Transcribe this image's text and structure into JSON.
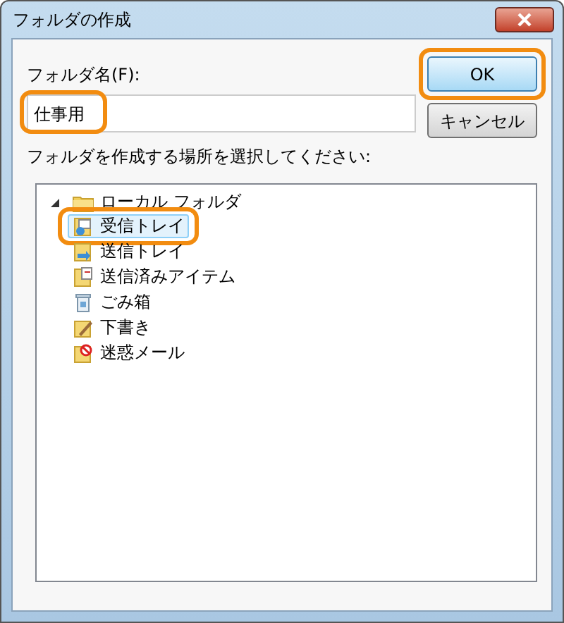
{
  "window": {
    "title": "フォルダの作成"
  },
  "name_field": {
    "label": "フォルダ名(F):",
    "value": "仕事用",
    "highlighted": true
  },
  "buttons": [
    {
      "label": "OK",
      "default": true,
      "highlighted": true
    },
    {
      "label": "キャンセル",
      "default": false,
      "highlighted": false
    }
  ],
  "location_label": "フォルダを作成する場所を選択してください:",
  "tree": {
    "items": [
      {
        "label": "ローカル フォルダ",
        "kind": "folder",
        "expanded": true,
        "selected": false,
        "highlighted": false,
        "children": [
          {
            "label": "受信トレイ",
            "kind": "inbox",
            "selected": true,
            "highlighted": true
          },
          {
            "label": "送信トレイ",
            "kind": "outbox",
            "selected": false,
            "highlighted": false
          },
          {
            "label": "送信済みアイテム",
            "kind": "sent",
            "selected": false,
            "highlighted": false
          },
          {
            "label": "ごみ箱",
            "kind": "trash",
            "selected": false,
            "highlighted": false
          },
          {
            "label": "下書き",
            "kind": "drafts",
            "selected": false,
            "highlighted": false
          },
          {
            "label": "迷惑メール",
            "kind": "junk",
            "selected": false,
            "highlighted": false
          }
        ]
      }
    ]
  }
}
